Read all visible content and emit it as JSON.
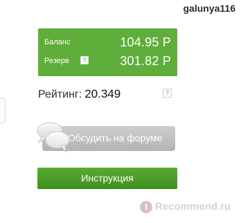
{
  "user": {
    "username": "galunya116"
  },
  "balance_panel": {
    "balance_label": "Баланс",
    "balance_value": "104.95 Р",
    "reserve_label": "Резерв",
    "reserve_value": "301.82 Р",
    "help_glyph": "?",
    "background_color": "#5fae3b"
  },
  "rating": {
    "label": "Рейтинг:",
    "value": "20.349",
    "help_glyph": "?"
  },
  "forum_button": {
    "label": "Обсудить на форуме",
    "icon": "speech-bubbles-icon"
  },
  "instructions_button": {
    "label": "Инструкция",
    "background_color": "#4c9c28"
  },
  "watermark": {
    "badge": "I",
    "text": "Recommend.ru"
  }
}
